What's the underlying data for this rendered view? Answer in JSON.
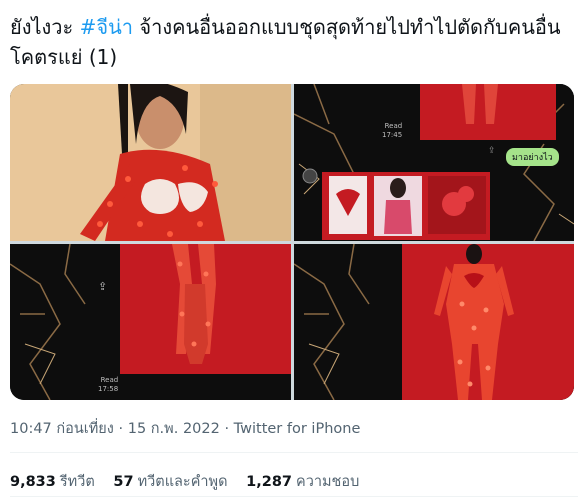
{
  "tweet": {
    "text_before": "ยังไงวะ ",
    "hashtag": "#จีน่า",
    "text_after": " จ้างคนอื่นออกแบบชุดสุดท้ายไปทำไปตัดกับคนอื่น โคตรแย่ (1)"
  },
  "media": {
    "overlays": {
      "read_a": "Read",
      "time_a": "17:45",
      "chat_bubble": "มาอย่างไว",
      "read_b": "Read",
      "time_b": "17:58"
    }
  },
  "meta": {
    "timestamp": "10:47 ก่อนเที่ยง · 15 ก.พ. 2022 · Twitter for iPhone"
  },
  "stats": {
    "retweets_count": "9,833",
    "retweets_label": "รีทวีต",
    "quotes_count": "57",
    "quotes_label": "ทวีตและคำพูด",
    "likes_count": "1,287",
    "likes_label": "ความชอบ"
  },
  "colors": {
    "accent": "#1d9bf0",
    "red": "#d71920",
    "chat_green": "#a5e38a"
  }
}
